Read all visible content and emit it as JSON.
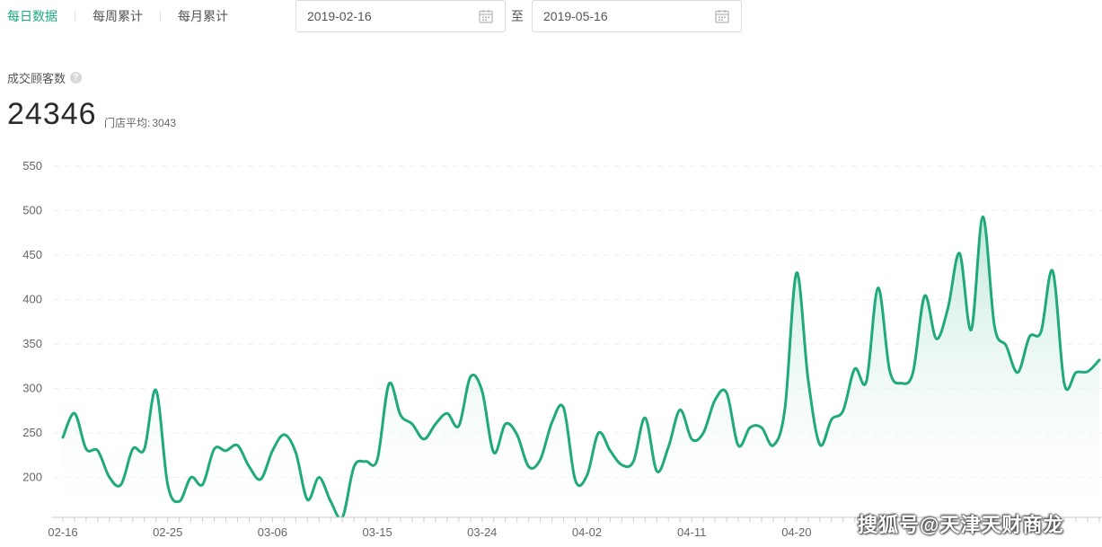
{
  "tabs": [
    {
      "label": "每日数据",
      "active": true
    },
    {
      "label": "每周累计",
      "active": false
    },
    {
      "label": "每月累计",
      "active": false
    }
  ],
  "date_range": {
    "start": "2019-02-16",
    "separator": "至",
    "end": "2019-05-16"
  },
  "metric": {
    "label": "成交顾客数",
    "help_icon": "question-circle-icon",
    "value": "24346",
    "avg_label": "门店平均:",
    "avg_value": "3043"
  },
  "watermark": "搜狐号@天津天财商龙",
  "colors": {
    "accent": "#1aaa82",
    "line": "#1fa97c",
    "fill_top": "#bfe7d9",
    "grid": "#eeeeee",
    "axis_text": "#666666"
  },
  "chart_data": {
    "type": "area",
    "title": "",
    "xlabel": "",
    "ylabel": "",
    "ylim": [
      150,
      550
    ],
    "yticks": [
      200,
      250,
      300,
      350,
      400,
      450,
      500,
      550
    ],
    "grid": true,
    "smooth": true,
    "x_tick_labels": [
      "02-16",
      "02-25",
      "03-06",
      "03-15",
      "03-24",
      "04-02",
      "04-11",
      "04-20"
    ],
    "x": [
      "02-16",
      "02-17",
      "02-18",
      "02-19",
      "02-20",
      "02-21",
      "02-22",
      "02-23",
      "02-24",
      "02-25",
      "02-26",
      "02-27",
      "02-28",
      "03-01",
      "03-02",
      "03-03",
      "03-04",
      "03-05",
      "03-06",
      "03-07",
      "03-08",
      "03-09",
      "03-10",
      "03-11",
      "03-12",
      "03-13",
      "03-14",
      "03-15",
      "03-16",
      "03-17",
      "03-18",
      "03-19",
      "03-20",
      "03-21",
      "03-22",
      "03-23",
      "03-24",
      "03-25",
      "03-26",
      "03-27",
      "03-28",
      "03-29",
      "03-30",
      "03-31",
      "04-01",
      "04-02",
      "04-03",
      "04-04",
      "04-05",
      "04-06",
      "04-07",
      "04-08",
      "04-09",
      "04-10",
      "04-11",
      "04-12",
      "04-13",
      "04-14",
      "04-15",
      "04-16",
      "04-17",
      "04-18",
      "04-19",
      "04-20",
      "04-21",
      "04-22",
      "04-23",
      "04-24",
      "04-25",
      "04-26",
      "04-27",
      "04-28",
      "04-29",
      "04-30",
      "05-01",
      "05-02",
      "05-03",
      "05-04",
      "05-05",
      "05-06",
      "05-07",
      "05-08",
      "05-09",
      "05-10",
      "05-11",
      "05-12",
      "05-13",
      "05-14",
      "05-15",
      "05-16"
    ],
    "values": [
      245,
      272,
      232,
      230,
      200,
      192,
      232,
      232,
      298,
      192,
      173,
      200,
      192,
      232,
      230,
      236,
      212,
      198,
      230,
      248,
      228,
      175,
      200,
      173,
      155,
      212,
      218,
      220,
      305,
      270,
      260,
      243,
      260,
      272,
      258,
      313,
      297,
      228,
      260,
      248,
      212,
      220,
      262,
      278,
      197,
      202,
      250,
      230,
      214,
      218,
      267,
      207,
      234,
      276,
      243,
      250,
      287,
      295,
      236,
      256,
      256,
      236,
      277,
      430,
      310,
      237,
      265,
      275,
      322,
      308,
      413,
      320,
      306,
      318,
      404,
      356,
      390,
      452,
      366,
      493,
      370,
      348,
      318,
      358,
      364,
      432,
      305,
      318,
      319,
      332
    ]
  }
}
